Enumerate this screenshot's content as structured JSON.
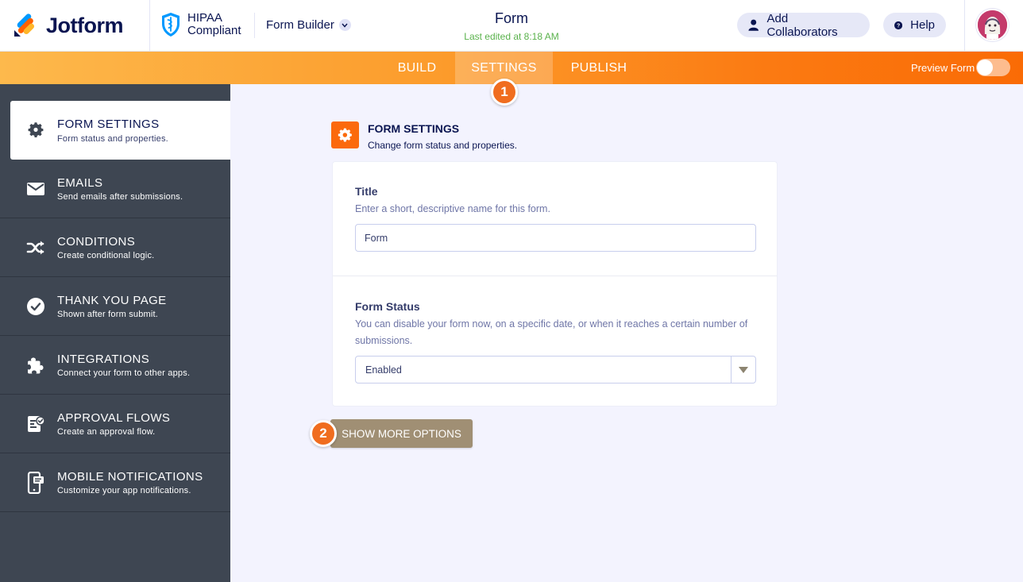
{
  "header": {
    "brand": "Jotform",
    "hipaa_line1": "HIPAA",
    "hipaa_line2": "Compliant",
    "form_builder_label": "Form Builder",
    "form_name": "Form",
    "last_edited": "Last edited at 8:18 AM",
    "add_collaborators_label": "Add Collaborators",
    "help_label": "Help"
  },
  "nav": {
    "tabs": [
      {
        "label": "BUILD",
        "active": false
      },
      {
        "label": "SETTINGS",
        "active": true
      },
      {
        "label": "PUBLISH",
        "active": false
      }
    ],
    "preview_label": "Preview Form",
    "preview_enabled": false
  },
  "annotations": {
    "step1": "1",
    "step2": "2"
  },
  "sidebar": {
    "items": [
      {
        "title": "FORM SETTINGS",
        "subtitle": "Form status and properties.",
        "icon": "gear-icon",
        "active": true
      },
      {
        "title": "EMAILS",
        "subtitle": "Send emails after submissions.",
        "icon": "envelope-icon",
        "active": false
      },
      {
        "title": "CONDITIONS",
        "subtitle": "Create conditional logic.",
        "icon": "shuffle-icon",
        "active": false
      },
      {
        "title": "THANK YOU PAGE",
        "subtitle": "Shown after form submit.",
        "icon": "check-circle-icon",
        "active": false
      },
      {
        "title": "INTEGRATIONS",
        "subtitle": "Connect your form to other apps.",
        "icon": "puzzle-icon",
        "active": false
      },
      {
        "title": "APPROVAL FLOWS",
        "subtitle": "Create an approval flow.",
        "icon": "approval-icon",
        "active": false
      },
      {
        "title": "MOBILE NOTIFICATIONS",
        "subtitle": "Customize your app notifications.",
        "icon": "mobile-icon",
        "active": false
      }
    ]
  },
  "main": {
    "section_title": "FORM SETTINGS",
    "section_subtitle": "Change form status and properties.",
    "title_field": {
      "label": "Title",
      "description": "Enter a short, descriptive name for this form.",
      "value": "Form"
    },
    "status_field": {
      "label": "Form Status",
      "description": "You can disable your form now, on a specific date, or when it reaches a certain number of submissions.",
      "selected": "Enabled"
    },
    "show_more_label": "SHOW MORE OPTIONS"
  },
  "colors": {
    "accent_orange": "#fb6a0c",
    "navy": "#0a1551",
    "sidebar_bg": "#3e4652",
    "button_tan": "#a08f74",
    "last_edited_green": "#5ab24c"
  }
}
